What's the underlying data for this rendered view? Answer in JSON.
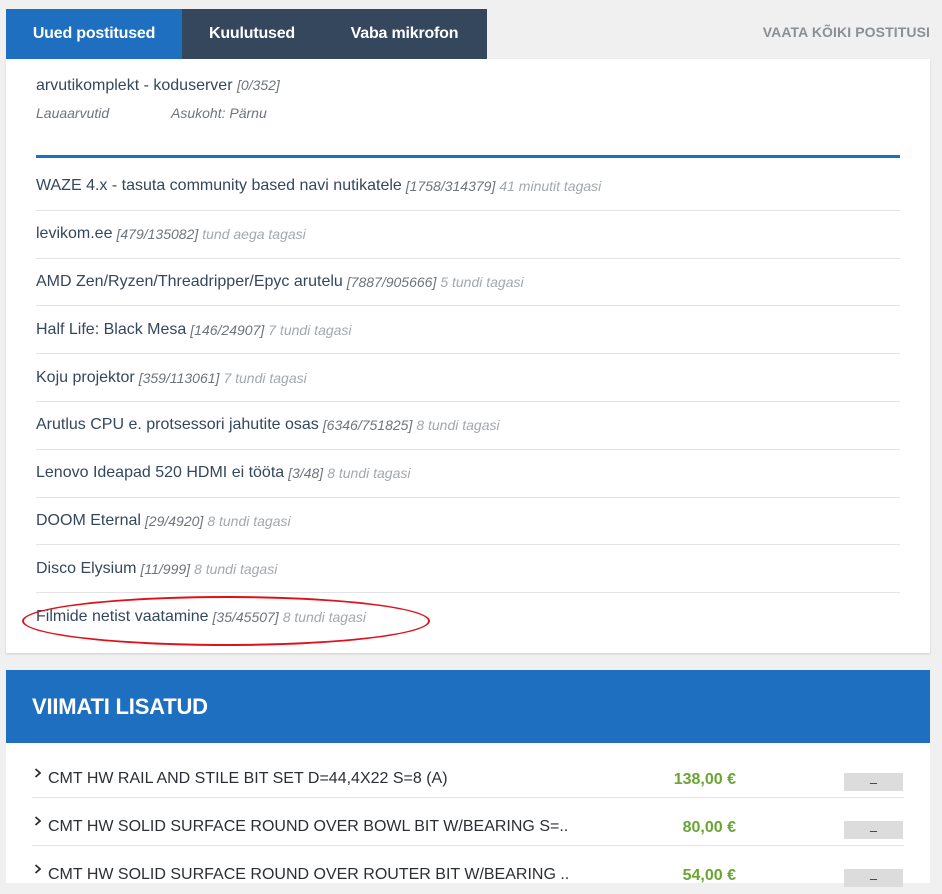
{
  "tabs": [
    {
      "label": "Uued postitused"
    },
    {
      "label": "Kuulutused"
    },
    {
      "label": "Vaba mikrofon"
    }
  ],
  "view_all": "VAATA KÕIKI POSTITUSI",
  "featured": {
    "title": "arvutikomplekt - koduserver",
    "count": "[0/352]",
    "category": "Lauaarvutid",
    "location": "Asukoht: Pärnu"
  },
  "topics": [
    {
      "title": "WAZE 4.x - tasuta community based navi nutikatele",
      "count": "[1758/314379]",
      "ago": "41 minutit tagasi"
    },
    {
      "title": "levikom.ee",
      "count": "[479/135082]",
      "ago": "tund aega tagasi"
    },
    {
      "title": "AMD Zen/Ryzen/Threadripper/Epyc arutelu",
      "count": "[7887/905666]",
      "ago": "5 tundi tagasi"
    },
    {
      "title": "Half Life: Black Mesa",
      "count": "[146/24907]",
      "ago": "7 tundi tagasi"
    },
    {
      "title": "Koju projektor",
      "count": "[359/113061]",
      "ago": "7 tundi tagasi"
    },
    {
      "title": "Arutlus CPU e. protsessori jahutite osas",
      "count": "[6346/751825]",
      "ago": "8 tundi tagasi"
    },
    {
      "title": "Lenovo Ideapad 520 HDMI ei tööta",
      "count": "[3/48]",
      "ago": "8 tundi tagasi"
    },
    {
      "title": "DOOM Eternal",
      "count": "[29/4920]",
      "ago": "8 tundi tagasi"
    },
    {
      "title": "Disco Elysium",
      "count": "[11/999]",
      "ago": "8 tundi tagasi"
    },
    {
      "title": "Filmide netist vaatamine",
      "count": "[35/45507]",
      "ago": "8 tundi tagasi"
    }
  ],
  "recent": {
    "heading": "VIIMATI LISATUD",
    "items": [
      {
        "name": "CMT HW RAIL AND STILE BIT SET D=44,4X22 S=8 (A)",
        "price": "138,00 €",
        "button": "–"
      },
      {
        "name": "CMT HW SOLID SURFACE ROUND OVER BOWL BIT W/BEARING S=...",
        "price": "80,00 €",
        "button": "–"
      },
      {
        "name": "CMT HW SOLID SURFACE ROUND OVER ROUTER BIT W/BEARING ...",
        "price": "54,00 €",
        "button": "–"
      }
    ]
  },
  "colors": {
    "accent": "#1f6fc0",
    "tab_dark": "#35475d",
    "price_green": "#6aa531",
    "highlight_red": "#e0101a"
  }
}
